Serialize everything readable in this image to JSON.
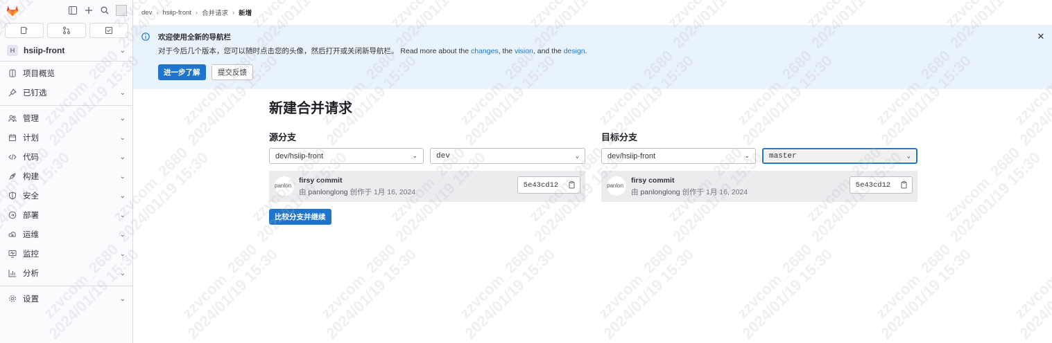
{
  "sidebar": {
    "project_initial": "H",
    "project_name": "hsiip-front",
    "items": [
      {
        "label": "项目概览",
        "icon": "project-icon",
        "has_chevron": false
      },
      {
        "label": "已钉选",
        "icon": "pin-icon",
        "has_chevron": true
      },
      {
        "label": "管理",
        "icon": "users-icon",
        "has_chevron": true
      },
      {
        "label": "计划",
        "icon": "calendar-icon",
        "has_chevron": true
      },
      {
        "label": "代码",
        "icon": "code-icon",
        "has_chevron": true
      },
      {
        "label": "构建",
        "icon": "rocket-icon",
        "has_chevron": true
      },
      {
        "label": "安全",
        "icon": "shield-icon",
        "has_chevron": true
      },
      {
        "label": "部署",
        "icon": "deployments-icon",
        "has_chevron": true
      },
      {
        "label": "运维",
        "icon": "cloud-gear-icon",
        "has_chevron": true
      },
      {
        "label": "监控",
        "icon": "monitor-icon",
        "has_chevron": true
      },
      {
        "label": "分析",
        "icon": "chart-icon",
        "has_chevron": true
      },
      {
        "label": "设置",
        "icon": "settings-icon",
        "has_chevron": true
      }
    ]
  },
  "breadcrumb": [
    "dev",
    "hsiip-front",
    "合并请求",
    "新增"
  ],
  "banner": {
    "title": "欢迎使用全新的导航栏",
    "body_prefix": "对于今后几个版本，您可以随时点击您的头像，然后打开或关闭新导航栏。 Read more about the ",
    "link_changes": "changes",
    "sep1": ", the ",
    "link_vision": "vision",
    "sep2": ", and the ",
    "link_design": "design",
    "suffix": ".",
    "learn_more": "进一步了解",
    "feedback": "提交反馈"
  },
  "page_title": "新建合并请求",
  "source": {
    "label": "源分支",
    "project": "dev/hsiip-front",
    "branch": "dev",
    "commit_title": "firsy commit",
    "avatar_alt": "panlon",
    "meta_by": "由 ",
    "author": "panlonglong",
    "meta_created": " 创作于 1月 16, 2024",
    "sha": "5e43cd12"
  },
  "target": {
    "label": "目标分支",
    "project": "dev/hsiip-front",
    "branch": "master",
    "commit_title": "firsy commit",
    "avatar_alt": "panlon",
    "meta_by": "由 ",
    "author": "panlonglong",
    "meta_created": " 创作于 1月 16, 2024",
    "sha": "5e43cd12"
  },
  "compare_button": "比较分支并继续",
  "watermark": "zzvcom_2680\n2024/01/19 15:30",
  "colors": {
    "primary": "#1f75cb",
    "banner_bg": "#e9f3fc",
    "sidebar_bg": "#fbfafd"
  }
}
